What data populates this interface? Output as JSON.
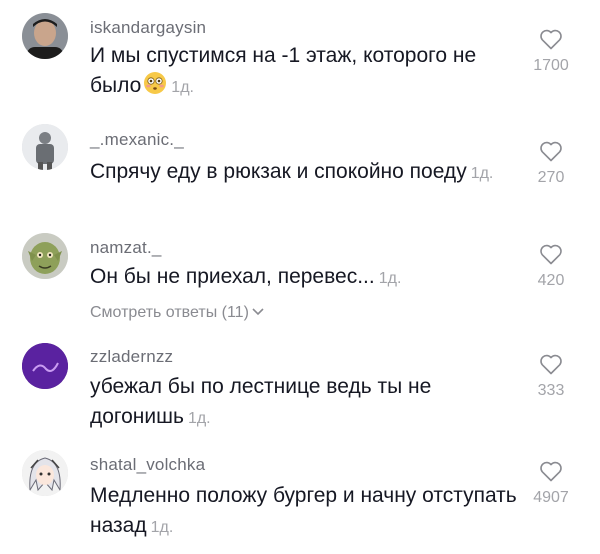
{
  "comments": [
    {
      "username": "iskandargaysin",
      "text": "И мы спустимся на -1 этаж, которого не было",
      "time": "1д.",
      "likes": "1700",
      "emoji": "flushed-face-emoji"
    },
    {
      "username": "_.mexanic._",
      "text": "Спрячу еду в рюкзак и спокойно поеду",
      "time": "1д.",
      "likes": "270"
    },
    {
      "username": "namzat._",
      "text": "Он бы не приехал, перевес...",
      "time": "1д.",
      "likes": "420",
      "replies_label": "Смотреть ответы (11)"
    },
    {
      "username": "zzladernzz",
      "text": "убежал бы по лестнице ведь ты не догонишь",
      "time": "1д.",
      "likes": "333"
    },
    {
      "username": "shatal_volchka",
      "text": "Медленно положу бургер и начну отступать назад",
      "time": "1д.",
      "likes": "4907"
    }
  ],
  "icons": {
    "like": "heart-outline-icon",
    "replies": "chevron-down-icon"
  },
  "colors": {
    "username": "#6b6d75",
    "meta": "#a3a4a9",
    "text": "#161823"
  }
}
